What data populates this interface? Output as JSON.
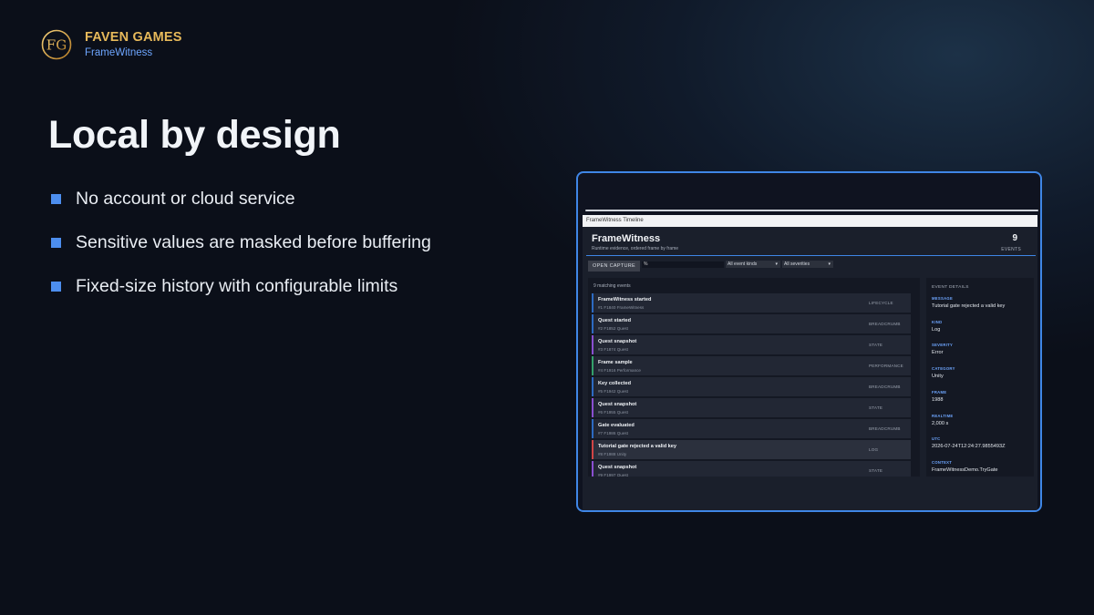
{
  "brand": {
    "name": "FAVEN GAMES",
    "product": "FrameWitness",
    "logo_text": "FG",
    "accent": "#e7b95a"
  },
  "headline": "Local by design",
  "bullets": [
    "No account or cloud service",
    "Sensitive values are masked before buffering",
    "Fixed-size history with configurable limits"
  ],
  "screenshot": {
    "tab_label": "FrameWitness Timeline",
    "title": "FrameWitness",
    "subtitle": "Runtime evidence, ordered frame by frame",
    "event_count": "9",
    "event_count_label": "EVENTS",
    "open_capture_label": "OPEN CAPTURE",
    "search_value": "%",
    "kind_filter": "All event kinds",
    "severity_filter": "All severities",
    "matching": "9 matching events",
    "events": [
      {
        "title": "FrameWitness started",
        "meta": "#1  F1840  FrameWitness",
        "kind": "LIFECYCLE",
        "color": "#2d6ac2"
      },
      {
        "title": "Quest started",
        "meta": "#2  F1852  Quest",
        "kind": "BREADCRUMB",
        "color": "#2d6ac2"
      },
      {
        "title": "Quest snapshot",
        "meta": "#3  F1874  Quest",
        "kind": "STATE",
        "color": "#8a4fd0"
      },
      {
        "title": "Frame sample",
        "meta": "#4  F1916  Performance",
        "kind": "PERFORMANCE",
        "color": "#34a06a"
      },
      {
        "title": "Key collected",
        "meta": "#5  F1942  Quest",
        "kind": "BREADCRUMB",
        "color": "#2d6ac2"
      },
      {
        "title": "Quest snapshot",
        "meta": "#6  F1955  Quest",
        "kind": "STATE",
        "color": "#8a4fd0"
      },
      {
        "title": "Gate evaluated",
        "meta": "#7  F1986  Quest",
        "kind": "BREADCRUMB",
        "color": "#2d6ac2"
      },
      {
        "title": "Tutorial gate rejected a valid key",
        "meta": "#8  F1988  Unity",
        "kind": "LOG",
        "color": "#d04545",
        "selected": true
      },
      {
        "title": "Quest snapshot",
        "meta": "#9  F1997  Quest",
        "kind": "STATE",
        "color": "#8a4fd0"
      }
    ],
    "details": {
      "heading": "EVENT DETAILS",
      "fields": [
        {
          "label": "MESSAGE",
          "value": "Tutorial gate rejected a valid key"
        },
        {
          "label": "KIND",
          "value": "Log"
        },
        {
          "label": "SEVERITY",
          "value": "Error"
        },
        {
          "label": "CATEGORY",
          "value": "Unity"
        },
        {
          "label": "FRAME",
          "value": "1988"
        },
        {
          "label": "REALTIME",
          "value": "2,000 s"
        },
        {
          "label": "UTC",
          "value": "2026-07-24T12:24:27.9855493Z"
        },
        {
          "label": "CONTEXT",
          "value": "FrameWitnessDemo.TryGate"
        }
      ]
    }
  }
}
